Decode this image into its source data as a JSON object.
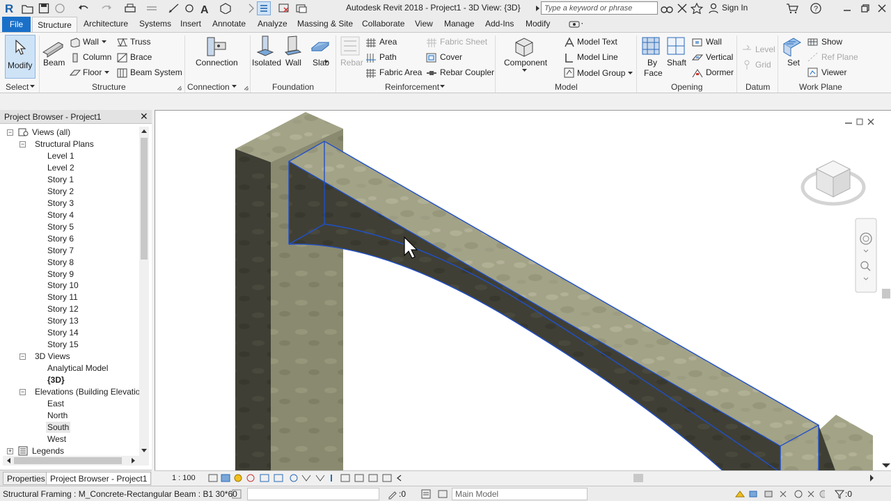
{
  "titlebar": {
    "app_title": "Autodesk Revit 2018 -    Project1 - 3D View: {3D}",
    "search_placeholder": "Type a keyword or phrase",
    "sign_in": "Sign In"
  },
  "tabs": {
    "file": "File",
    "structure": "Structure",
    "architecture": "Architecture",
    "systems": "Systems",
    "insert": "Insert",
    "annotate": "Annotate",
    "analyze": "Analyze",
    "massing": "Massing & Site",
    "collaborate": "Collaborate",
    "view": "View",
    "manage": "Manage",
    "addins": "Add-Ins",
    "modify": "Modify"
  },
  "ribbon": {
    "select": {
      "modify": "Modify",
      "panel": "Select"
    },
    "structure": {
      "beam": "Beam",
      "wall": "Wall",
      "column": "Column",
      "floor": "Floor",
      "truss": "Truss",
      "brace": "Brace",
      "beam_system": "Beam  System",
      "panel": "Structure"
    },
    "connection": {
      "connection": "Connection",
      "panel": "Connection"
    },
    "foundation": {
      "isolated": "Isolated",
      "wall": "Wall",
      "slab": "Slab",
      "panel": "Foundation"
    },
    "reinforcement": {
      "rebar": "Rebar",
      "area": "Area",
      "path": "Path",
      "fabric_area": "Fabric  Area",
      "fabric_sheet": "Fabric  Sheet",
      "cover": "Cover",
      "rebar_coupler": "Rebar  Coupler",
      "panel": "Reinforcement"
    },
    "model": {
      "component": "Component",
      "model_text": "Model  Text",
      "model_line": "Model  Line",
      "model_group": "Model  Group",
      "panel": "Model"
    },
    "opening": {
      "by_face": "By\nFace",
      "by": "By",
      "face": "Face",
      "shaft": "Shaft",
      "wall": "Wall",
      "vertical": "Vertical",
      "dormer": "Dormer",
      "panel": "Opening"
    },
    "datum": {
      "level": "Level",
      "grid": "Grid",
      "panel": "Datum"
    },
    "workplane": {
      "set": "Set",
      "show": "Show",
      "ref_plane": "Ref  Plane",
      "viewer": "Viewer",
      "panel": "Work Plane"
    }
  },
  "project_browser": {
    "title": "Project Browser - Project1",
    "views_all": "Views (all)",
    "structural_plans": "Structural Plans",
    "plans": [
      "Level 1",
      "Level 2",
      "Story 1",
      "Story 2",
      "Story 3",
      "Story 4",
      "Story 5",
      "Story 6",
      "Story 7",
      "Story 8",
      "Story 9",
      "Story 10",
      "Story 11",
      "Story 12",
      "Story 13",
      "Story 14",
      "Story 15"
    ],
    "views_3d": "3D Views",
    "analytical_model": "Analytical Model",
    "view_3d": "{3D}",
    "elevations": "Elevations (Building Elevation",
    "elevation_items": [
      "East",
      "North",
      "South",
      "West"
    ],
    "legends": "Legends",
    "tab_properties": "Properties",
    "tab_browser": "Project Browser - Project1"
  },
  "view_control": {
    "scale": "1 : 100"
  },
  "status": {
    "text": "Structural Framing : M_Concrete-Rectangular Beam : B1 30*60",
    "worksets": ":0",
    "model": "Main Model",
    "filter": ":0"
  },
  "colors": {
    "accent": "#1a70c9",
    "selection": "#2050c8"
  }
}
